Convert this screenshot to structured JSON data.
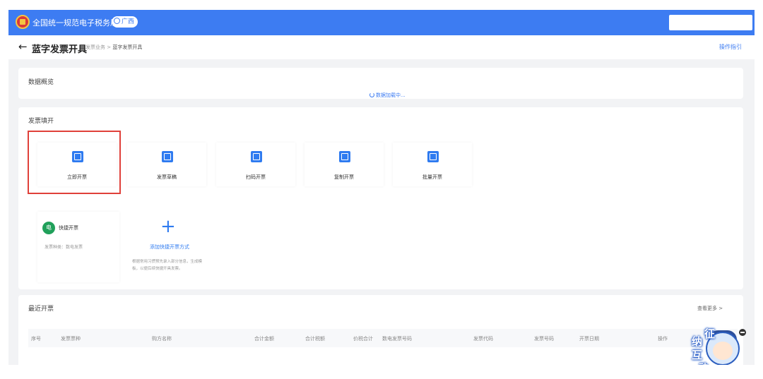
{
  "header": {
    "site_title": "全国统一规范电子税务局",
    "region": "广西",
    "search_placeholder": ""
  },
  "breadcrumb": {
    "back_symbol": "←",
    "page_title": "蓝字发票开具",
    "parent": "发票业务",
    "separator": ">",
    "current": "蓝字发票开具",
    "guide_link": "操作指引"
  },
  "overview": {
    "title": "数据概览",
    "loading_text": "数据加载中..."
  },
  "issue": {
    "title": "发票填开",
    "tiles": [
      {
        "label": "立即开票",
        "icon": "invoice-icon"
      },
      {
        "label": "发票草稿",
        "icon": "draft-icon"
      },
      {
        "label": "扫码开票",
        "icon": "qr-code-icon"
      },
      {
        "label": "复制开票",
        "icon": "copy-icon"
      },
      {
        "label": "批量开票",
        "icon": "batch-icon"
      }
    ],
    "quick": {
      "badge": "电",
      "title": "快捷开票",
      "desc": "发票种类：数电发票"
    },
    "add_quick": {
      "plus": "+",
      "label": "添加快捷开票方式",
      "desc": "根据常用习惯预先录入部分信息，生成模板，以便后续快捷开具发票。"
    }
  },
  "recent": {
    "title": "最近开票",
    "more": "查看更多 >",
    "columns": [
      "序号",
      "发票票种",
      "购方名称",
      "合计金额",
      "合计税额",
      "价税合计",
      "数电发票号码",
      "发票代码",
      "发票号码",
      "开票日期",
      "操作"
    ]
  },
  "mascot": {
    "chars": [
      "征",
      "纳",
      "互",
      "动"
    ]
  },
  "colors": {
    "brand": "#3d7cf2",
    "highlight": "#e0403a"
  }
}
